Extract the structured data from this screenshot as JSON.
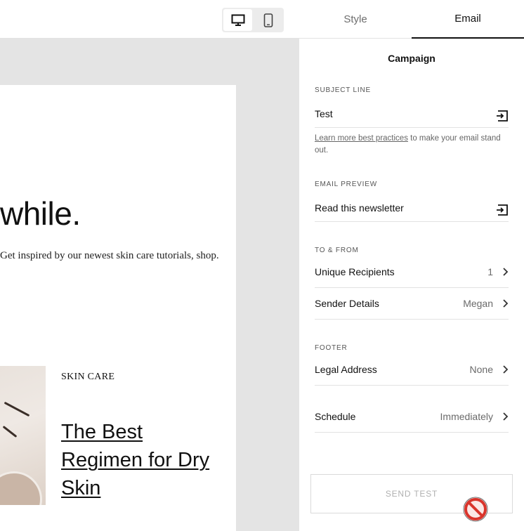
{
  "tabs": {
    "style": "Style",
    "email": "Email"
  },
  "device_toggle": {
    "desktop_icon": "desktop-icon",
    "mobile_icon": "mobile-icon",
    "active": "desktop"
  },
  "preview": {
    "headline": "while.",
    "intro": "Get inspired by our newest skin care tutorials, shop.",
    "category": "SKIN CARE",
    "article_title": "The Best Regimen for Dry Skin"
  },
  "panel": {
    "title": "Campaign",
    "subject": {
      "section_label": "SUBJECT LINE",
      "value": "Test",
      "icon": "insert-variable-icon",
      "helper_link": "Learn more best practices",
      "helper_text": " to make your email stand out."
    },
    "preview_text": {
      "section_label": "EMAIL PREVIEW",
      "value": "Read this newsletter",
      "icon": "insert-variable-icon"
    },
    "to_from": {
      "section_label": "TO & FROM",
      "recipients_label": "Unique Recipients",
      "recipients_value": "1",
      "sender_label": "Sender Details",
      "sender_value": "Megan"
    },
    "footer": {
      "section_label": "FOOTER",
      "legal_label": "Legal Address",
      "legal_value": "None"
    },
    "schedule": {
      "label": "Schedule",
      "value": "Immediately"
    },
    "send_test": "SEND TEST"
  },
  "cursor": "not-allowed-icon",
  "colors": {
    "accent": "#111111",
    "muted": "#6a6a6a",
    "canvas_bg": "#e4e4e4",
    "no_sign": "#d9342b"
  }
}
